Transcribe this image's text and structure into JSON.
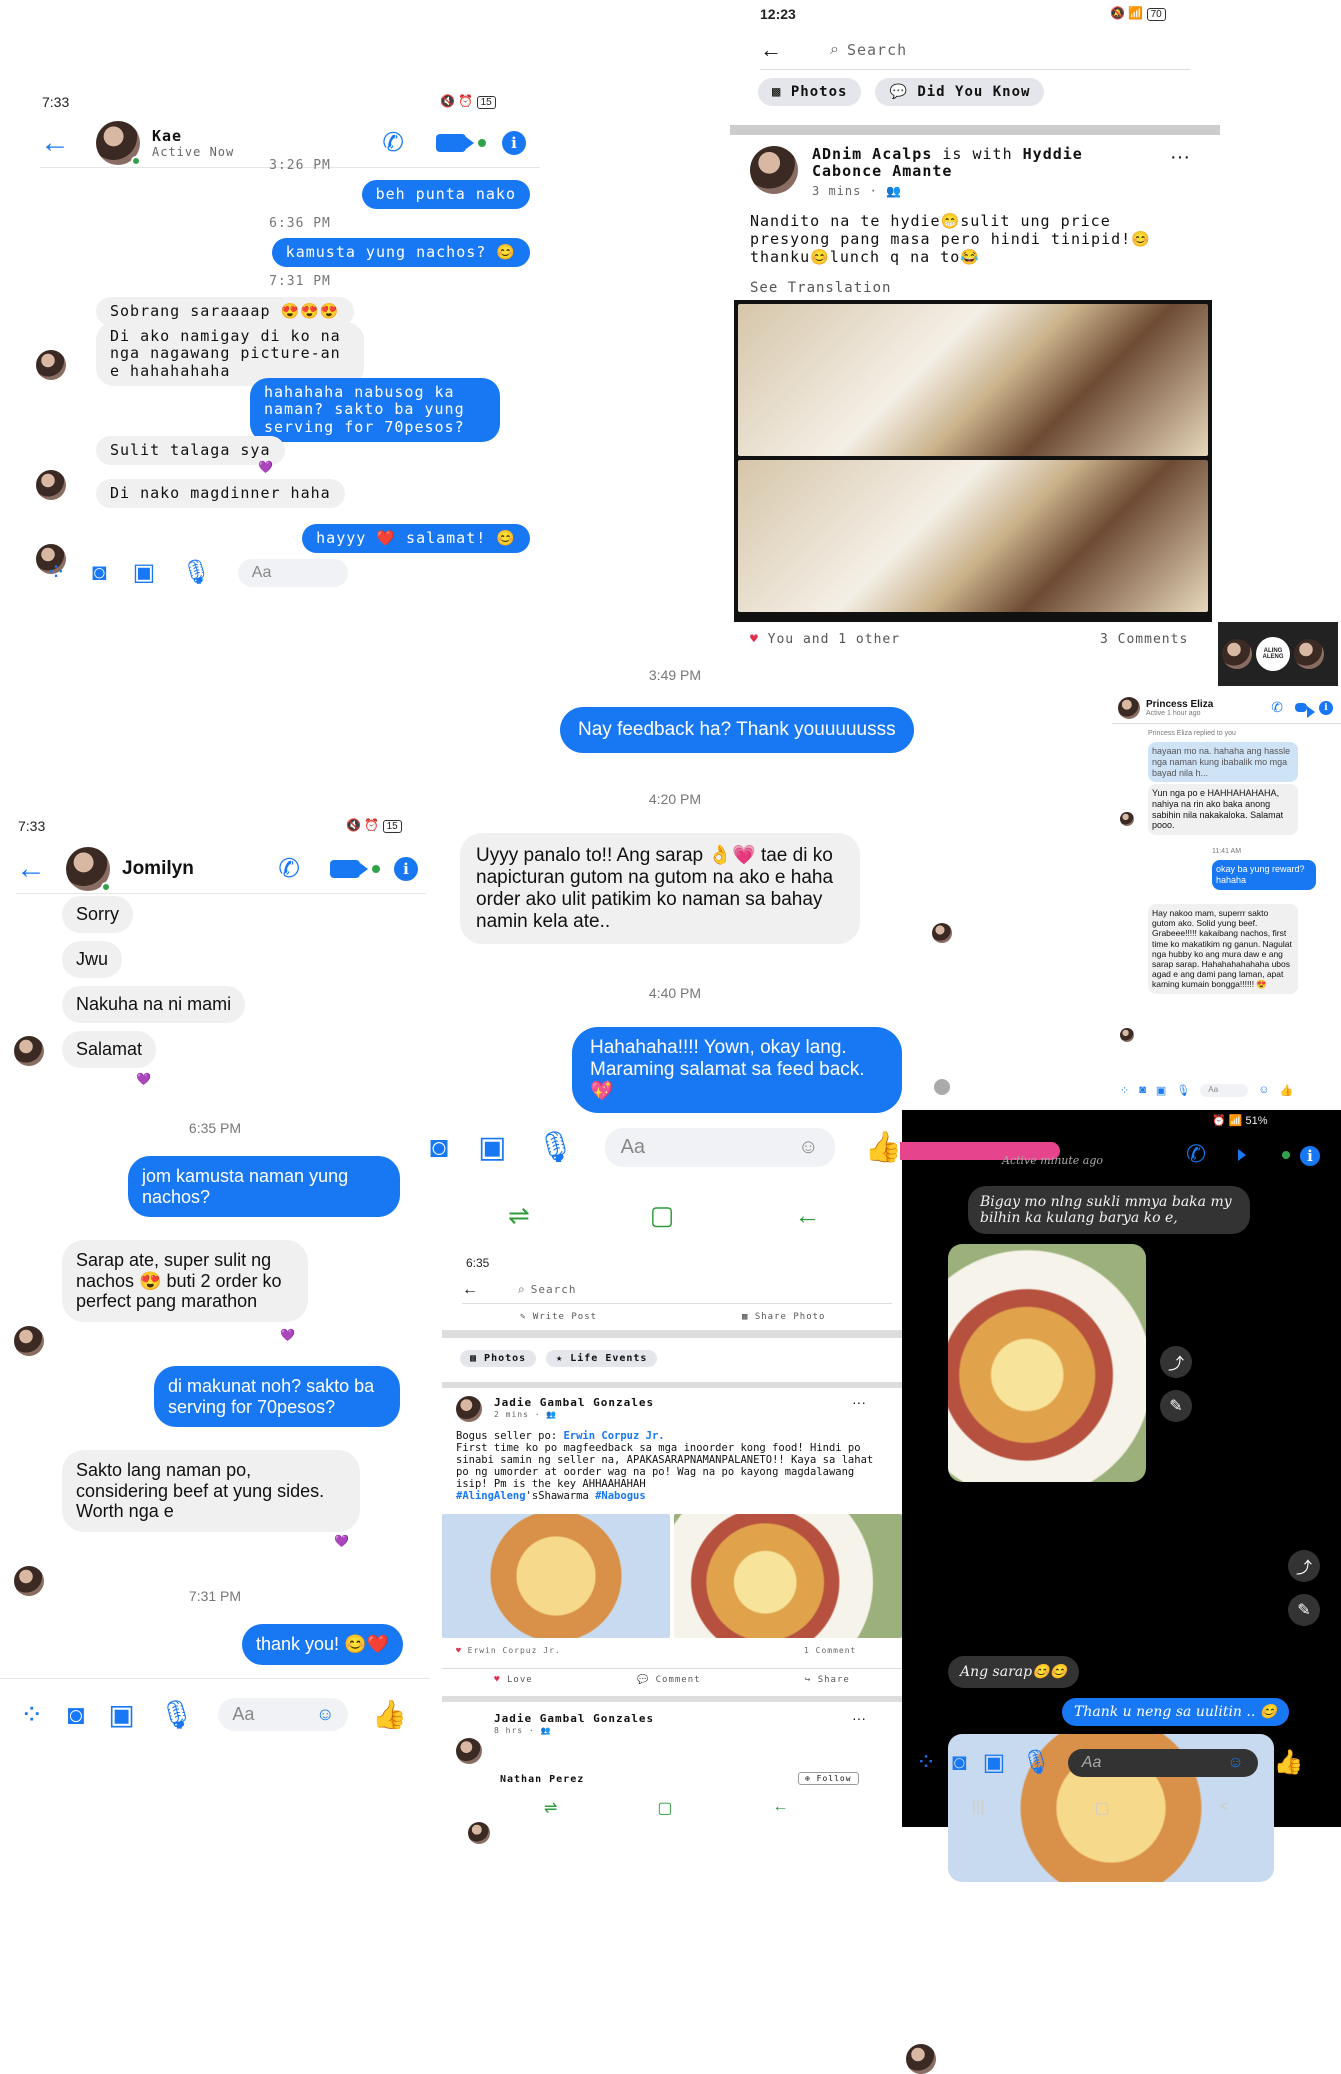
{
  "kae": {
    "status": "7:33",
    "battery": "15",
    "name": "Kae",
    "active": "Active Now",
    "messages": [
      {
        "ts": "3:26 PM"
      },
      {
        "out": "beh punta nako"
      },
      {
        "ts": "6:36 PM"
      },
      {
        "out": "kamusta yung nachos? 😊"
      },
      {
        "ts": "7:31 PM"
      },
      {
        "in": "Sobrang saraaaap 😍😍😍"
      },
      {
        "in": "Di ako namigay di ko na nga nagawang picture-an e hahahahaha"
      },
      {
        "out": "hahahaha nabusog ka naman? sakto ba yung serving for 70pesos?"
      },
      {
        "in": "Sulit talaga sya"
      },
      {
        "in": "Di nako magdinner haha"
      },
      {
        "out": "hayyy ❤️ salamat! 😊"
      }
    ],
    "composer": "Aa"
  },
  "fbpost": {
    "status": "12:23",
    "battery": "70",
    "search": "Search",
    "tab1": "Photos",
    "tab2": "Did You Know",
    "author": "ADnim Acalps",
    "with": "is with",
    "tagged": "Hyddie Cabonce Amante",
    "time": "3 mins ·",
    "text": "Nandito na te hydie😁sulit ung price presyong pang masa pero hindi tinipid!😊thanku😊lunch q na to😂",
    "see_translation": "See Translation",
    "likes": "You and 1 other",
    "comments": "3 Comments"
  },
  "center": {
    "ts1": "3:49 PM",
    "out1": "Nay feedback ha? Thank youuuuusss",
    "ts2": "4:20 PM",
    "in1": "Uyyy panalo to!! Ang sarap 👌💗 tae di ko napicturan gutom na gutom na ako e haha  order ako ulit patikim ko naman sa bahay namin kela ate..",
    "ts3": "4:40 PM",
    "out2": "Hahahaha!!!! Yown, okay lang. Maraming salamat sa feed back. 💖",
    "composer": "Aa"
  },
  "princess": {
    "name": "Princess Eliza",
    "active": "Active 1 hour ago",
    "replied": "Princess Eliza replied to you",
    "quote": "hayaan mo na. hahaha ang hassle nga naman kung ibabalik mo mga bayad nila h...",
    "in1": "Yun nga po e HAHHAHAHAHA, nahiya na rin ako baka anong sabihin nila nakakaloka. Salamat pooo.",
    "ts": "11:41 AM",
    "out1": "okay ba yung reward? hahaha",
    "in2": "Hay nakoo mam, superrr sakto gutom ako. Solid yung beef. Grabeee!!!!! kakaibang nachos, first time ko makatikim ng ganun. Nagulat nga hubby ko ang mura daw e ang sarap sarap. Hahahahahahaha ubos agad e ang dami pang laman, apat kaming kumain bongga!!!!!! 😍",
    "composer": "Aa",
    "logo": "ALING ALENG"
  },
  "jomilyn": {
    "status": "7:33",
    "battery": "15",
    "name": "Jomilyn",
    "in_top": [
      "Sorry",
      "Jwu",
      "Nakuha na ni mami",
      "Salamat"
    ],
    "ts1": "6:35 PM",
    "out1": "jom kamusta naman yung nachos?",
    "in1": "Sarap ate, super sulit ng nachos 😍 buti 2 order ko perfect pang marathon",
    "out2": "di makunat noh? sakto ba serving for 70pesos?",
    "in2": "Sakto lang naman po, considering beef at yung sides. Worth nga e",
    "ts2": "7:31 PM",
    "out3": "thank you! 😊❤️",
    "composer": "Aa"
  },
  "fb2": {
    "status": "6:35",
    "search": "Search",
    "write": "Write Post",
    "share_photo": "Share Photo",
    "tab1": "Photos",
    "tab2": "Life Events",
    "author": "Jadie Gambal Gonzales",
    "time": "2 mins ·",
    "line1_prefix": "Bogus seller po: ",
    "line1_tag": "Erwin Corpuz Jr.",
    "body": "First time ko po magfeedback sa mga inoorder kong food! Hindi po sinabi samin ng seller na, APAKASARAPNAMANPALANETO!! Kaya sa lahat po ng umorder at oorder wag na po! Wag na po kayong magdalawang isip! Pm is the key AHHAAHAHAH",
    "hash1": "#AlingAleng",
    "hash_mid": "'sShawarma ",
    "hash2": "#Nabogus",
    "reactor": "Erwin Corpuz Jr.",
    "comment_count": "1 Comment",
    "love": "Love",
    "comment": "Comment",
    "share": "Share",
    "author2": "Jadie Gambal Gonzales",
    "time2": "8 hrs ·",
    "author3": "Nathan Perez",
    "follow": "Follow"
  },
  "dark": {
    "status": "51%",
    "active": "Active  minute ago",
    "in1": "Bigay mo nlng sukli mmya baka my bilhin ka kulang barya ko e,",
    "in2": "Ang sarap😊😊",
    "out1": "Thank u neng sa uulitin .. 😊",
    "composer": "Aa"
  }
}
